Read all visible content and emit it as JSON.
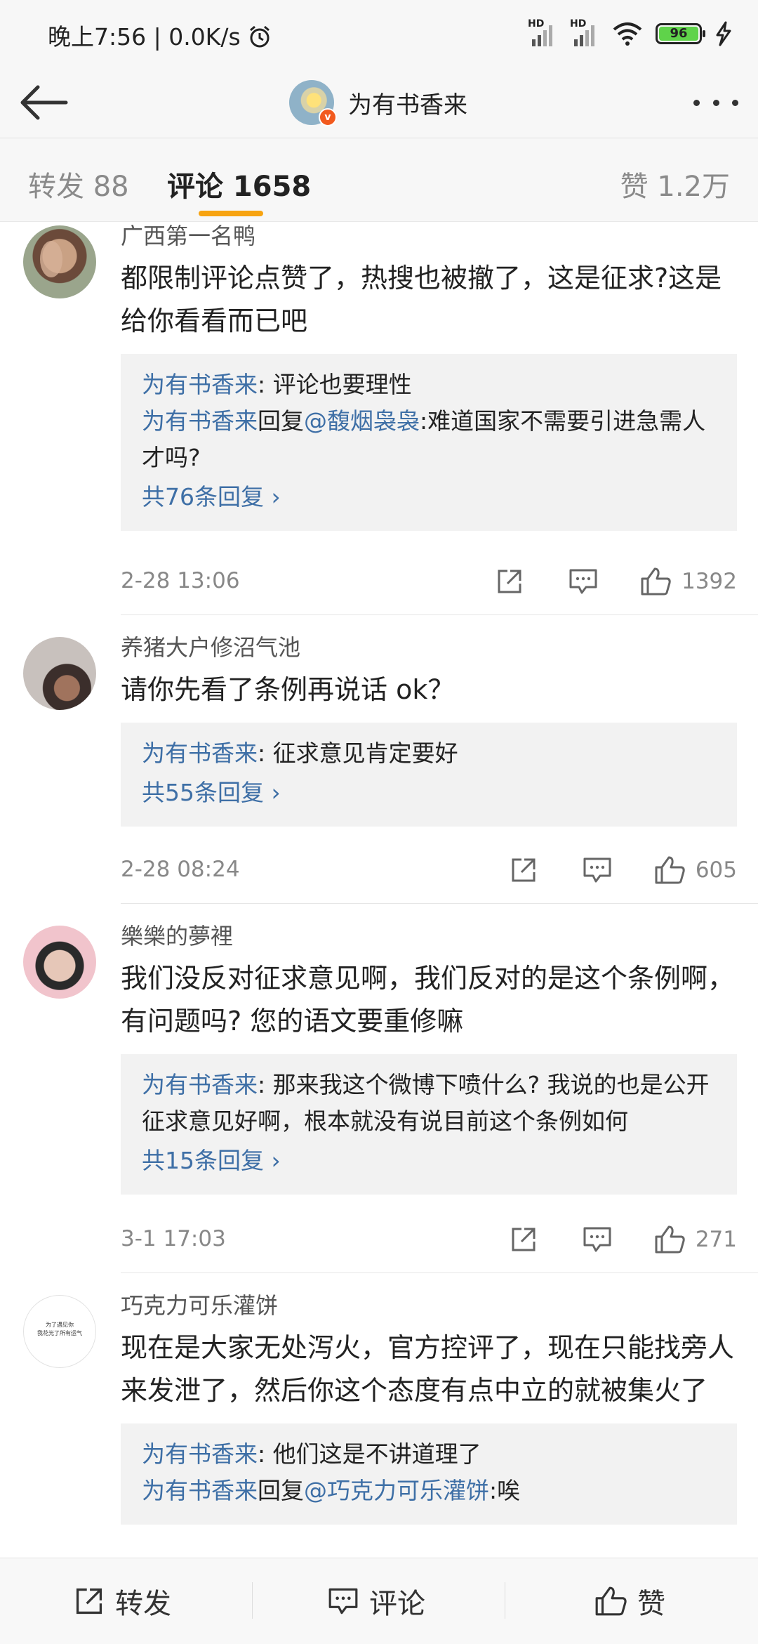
{
  "status_bar": {
    "time_speed": "晚上7:56 | 0.0K/s",
    "network1": "HD",
    "network2": "HD",
    "battery": "96"
  },
  "header": {
    "title": "为有书香来",
    "verified_badge": "v"
  },
  "tabs": [
    {
      "label": "转发 88"
    },
    {
      "label": "评论 1658"
    },
    {
      "label": "赞 1.2万"
    }
  ],
  "comments": [
    {
      "user": "广西第一名鸭",
      "text": "都限制评论点赞了，热搜也被撤了，这是征求?这是给你看看而已吧",
      "replies": [
        {
          "name": "为有书香来",
          "content": ": 评论也要理性"
        },
        {
          "name": "为有书香来",
          "mid": "回复",
          "target": "@馥烟袅袅",
          "content": ":难道国家不需要引进急需人才吗?"
        }
      ],
      "more_replies": "共76条回复 ›",
      "date": "2-28 13:06",
      "likes": "1392"
    },
    {
      "user": "养猪大户修沼气池",
      "text": "请你先看了条例再说话 ok？",
      "replies": [
        {
          "name": "为有书香来",
          "content": ": 征求意见肯定要好"
        }
      ],
      "more_replies": "共55条回复 ›",
      "date": "2-28 08:24",
      "likes": "605"
    },
    {
      "user": "樂樂的夢裡",
      "text": "我们没反对征求意见啊，我们反对的是这个条例啊，有问题吗? 您的语文要重修嘛",
      "replies": [
        {
          "name": "为有书香来",
          "content": ": 那来我这个微博下喷什么? 我说的也是公开征求意见好啊，根本就没有说目前这个条例如何"
        }
      ],
      "more_replies": "共15条回复 ›",
      "date": "3-1 17:03",
      "likes": "271"
    },
    {
      "user": "巧克力可乐灌饼",
      "avatar_text": "为了遇见你\n我花光了所有运气",
      "text": "现在是大家无处泻火，官方控评了，现在只能找旁人来发泄了，然后你这个态度有点中立的就被集火了",
      "replies": [
        {
          "name": "为有书香来",
          "content": ": 他们这是不讲道理了"
        },
        {
          "name": "为有书香来",
          "mid": "回复",
          "target": "@巧克力可乐灌饼",
          "content": ":唉"
        }
      ]
    }
  ],
  "bottom_bar": {
    "repost": "转发",
    "comment": "评论",
    "like": "赞"
  }
}
